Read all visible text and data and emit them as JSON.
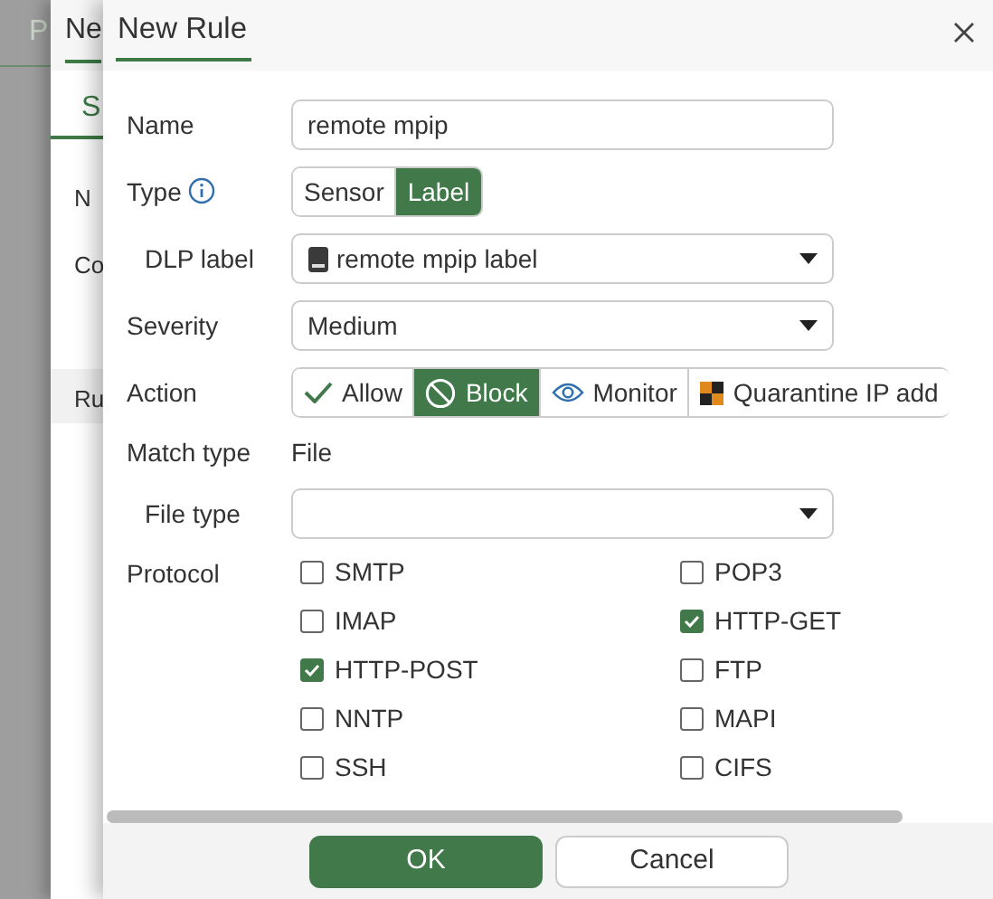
{
  "background_page": {
    "title": "P"
  },
  "background_dialog": {
    "title": "Ne",
    "tab": "S",
    "labels": [
      "N",
      "Co"
    ],
    "section": "Ru"
  },
  "dialog": {
    "title": "New Rule",
    "name": {
      "label": "Name",
      "value": "remote mpip"
    },
    "type": {
      "label": "Type",
      "options": [
        {
          "label": "Sensor",
          "selected": false
        },
        {
          "label": "Label",
          "selected": true
        }
      ]
    },
    "dlp_label": {
      "label": "DLP label",
      "value": "remote mpip label"
    },
    "severity": {
      "label": "Severity",
      "value": "Medium"
    },
    "action": {
      "label": "Action",
      "options": [
        {
          "label": "Allow",
          "kind": "allow",
          "selected": false
        },
        {
          "label": "Block",
          "kind": "block",
          "selected": true
        },
        {
          "label": "Monitor",
          "kind": "monitor",
          "selected": false
        },
        {
          "label": "Quarantine IP add",
          "kind": "quarantine",
          "selected": false
        }
      ]
    },
    "match_type": {
      "label": "Match type",
      "value": "File"
    },
    "file_type": {
      "label": "File type"
    },
    "protocol": {
      "label": "Protocol",
      "items": [
        {
          "label": "SMTP",
          "checked": false
        },
        {
          "label": "POP3",
          "checked": false
        },
        {
          "label": "IMAP",
          "checked": false
        },
        {
          "label": "HTTP-GET",
          "checked": true
        },
        {
          "label": "HTTP-POST",
          "checked": true
        },
        {
          "label": "FTP",
          "checked": false
        },
        {
          "label": "NNTP",
          "checked": false
        },
        {
          "label": "MAPI",
          "checked": false
        },
        {
          "label": "SSH",
          "checked": false
        },
        {
          "label": "CIFS",
          "checked": false
        }
      ]
    },
    "buttons": [
      {
        "label": "OK",
        "kind": "primary"
      },
      {
        "label": "Cancel",
        "kind": "secondary"
      }
    ]
  }
}
